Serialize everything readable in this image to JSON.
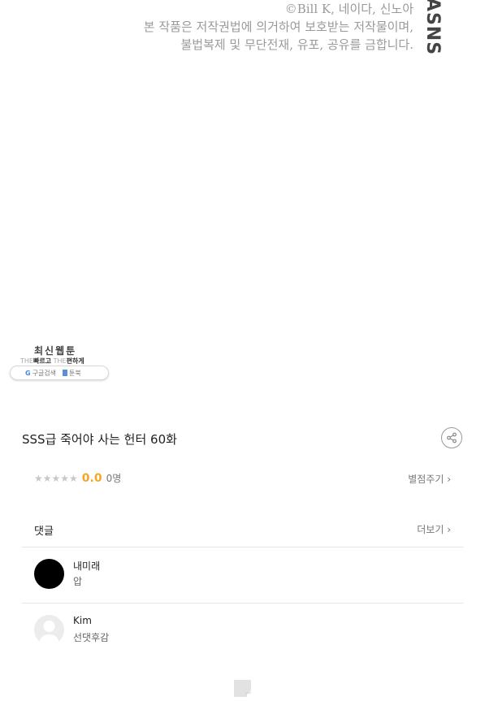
{
  "copyright": {
    "line1": "©Bill K, 네이다, 신노아",
    "line2": "본 작품은 저작권법에 의거하여 보호받는 저작물이며,",
    "line3": "불법복제 및 무단전재, 유포, 공유를 금합니다."
  },
  "brand_logo_text": "ASNS",
  "promo": {
    "title": "최신웹툰",
    "the1": "THE",
    "fast": "빠르고",
    "the2": "THE",
    "easy": "편하게",
    "search_g": "G",
    "search_label": "구글검색",
    "site_label": "툰북"
  },
  "episode": {
    "title": "SSS급 죽어야 사는 헌터 60화"
  },
  "rating": {
    "stars": "★★★★★",
    "score": "0.0",
    "count": "0명",
    "rate_link": "별점주기 ›"
  },
  "comments": {
    "label": "댓글",
    "more_link": "더보기 ›",
    "items": [
      {
        "name": "내미래",
        "text": "압"
      },
      {
        "name": "Kim",
        "text": "선댓후감"
      }
    ]
  }
}
